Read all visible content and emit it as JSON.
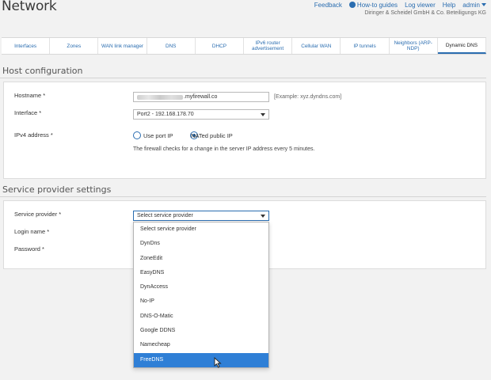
{
  "header": {
    "title": "Network",
    "company": "Diringer & Scheidel GmbH & Co. Beteiligungs KG",
    "links": {
      "feedback": "Feedback",
      "how_to": "How-to guides",
      "log_viewer": "Log viewer",
      "help": "Help",
      "user": "admin"
    }
  },
  "tabs": [
    "Interfaces",
    "Zones",
    "WAN link manager",
    "DNS",
    "DHCP",
    "IPv6 router advertisement",
    "Cellular WAN",
    "IP tunnels",
    "Neighbors (ARP-NDP)",
    "Dynamic DNS"
  ],
  "active_tab": "Dynamic DNS",
  "host_config": {
    "title": "Host configuration",
    "hostname_label": "Hostname *",
    "hostname_suffix": ".myfirewall.co",
    "hostname_hint": "[Example: xyz.dyndns.com]",
    "interface_label": "Interface *",
    "interface_value": "Port2 - 192.168.178.70",
    "ipv4_label": "IPv4 address *",
    "radio_use_port": "Use port IP",
    "radio_nated": "NATed public IP",
    "radio_selected": "NATed public IP",
    "note": "The firewall checks for a change in the server IP address every 5 minutes."
  },
  "service_provider": {
    "title": "Service provider settings",
    "provider_label": "Service provider *",
    "provider_value": "Select service provider",
    "login_label": "Login name *",
    "password_label": "Password *",
    "options": [
      "Select service provider",
      "DynDns",
      "ZoneEdit",
      "EasyDNS",
      "DynAccess",
      "No-IP",
      "DNS-O-Matic",
      "Google DDNS",
      "Namecheap",
      "FreeDNS"
    ],
    "highlighted_option": "FreeDNS"
  },
  "colors": {
    "accent": "#2a6db0",
    "highlight": "#2f7fd6",
    "background": "#f2f2f2"
  }
}
